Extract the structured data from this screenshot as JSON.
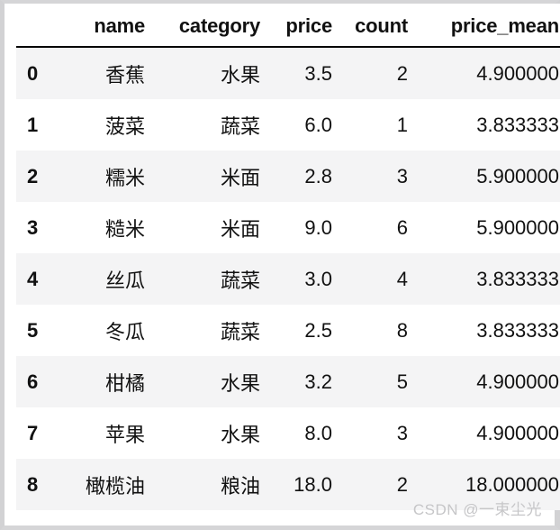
{
  "table": {
    "index_header": "",
    "columns": [
      {
        "key": "name",
        "label": "name"
      },
      {
        "key": "category",
        "label": "category"
      },
      {
        "key": "price",
        "label": "price"
      },
      {
        "key": "count",
        "label": "count"
      },
      {
        "key": "price_mean",
        "label": "price_mean"
      }
    ],
    "rows": [
      {
        "index": "0",
        "name": "香蕉",
        "category": "水果",
        "price": "3.5",
        "count": "2",
        "price_mean": "4.900000"
      },
      {
        "index": "1",
        "name": "菠菜",
        "category": "蔬菜",
        "price": "6.0",
        "count": "1",
        "price_mean": "3.833333"
      },
      {
        "index": "2",
        "name": "糯米",
        "category": "米面",
        "price": "2.8",
        "count": "3",
        "price_mean": "5.900000"
      },
      {
        "index": "3",
        "name": "糙米",
        "category": "米面",
        "price": "9.0",
        "count": "6",
        "price_mean": "5.900000"
      },
      {
        "index": "4",
        "name": "丝瓜",
        "category": "蔬菜",
        "price": "3.0",
        "count": "4",
        "price_mean": "3.833333"
      },
      {
        "index": "5",
        "name": "冬瓜",
        "category": "蔬菜",
        "price": "2.5",
        "count": "8",
        "price_mean": "3.833333"
      },
      {
        "index": "6",
        "name": "柑橘",
        "category": "水果",
        "price": "3.2",
        "count": "5",
        "price_mean": "4.900000"
      },
      {
        "index": "7",
        "name": "苹果",
        "category": "水果",
        "price": "8.0",
        "count": "3",
        "price_mean": "4.900000"
      },
      {
        "index": "8",
        "name": "橄榄油",
        "category": "粮油",
        "price": "18.0",
        "count": "2",
        "price_mean": "18.000000"
      }
    ]
  },
  "watermark": {
    "text": "CSDN @一束尘光"
  },
  "colors": {
    "stripe": "#f4f4f5",
    "background": "#ffffff",
    "text": "#111111",
    "header_rule": "#000000",
    "frame_border": "#d2d2d4",
    "watermark": "#c6c6c8"
  }
}
